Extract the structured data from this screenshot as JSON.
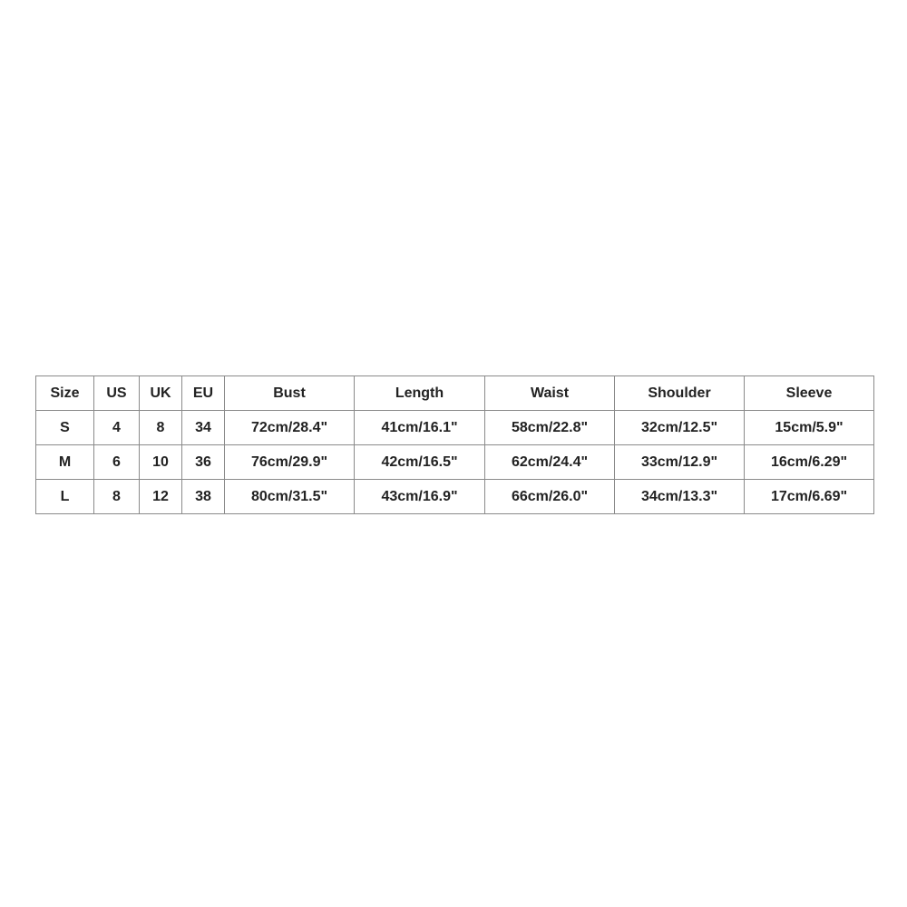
{
  "size_chart": {
    "headers": [
      "Size",
      "US",
      "UK",
      "EU",
      "Bust",
      "Length",
      "Waist",
      "Shoulder",
      "Sleeve"
    ],
    "rows": [
      [
        "S",
        "4",
        "8",
        "34",
        "72cm/28.4\"",
        "41cm/16.1\"",
        "58cm/22.8\"",
        "32cm/12.5\"",
        "15cm/5.9\""
      ],
      [
        "M",
        "6",
        "10",
        "36",
        "76cm/29.9\"",
        "42cm/16.5\"",
        "62cm/24.4\"",
        "33cm/12.9\"",
        "16cm/6.29\""
      ],
      [
        "L",
        "8",
        "12",
        "38",
        "80cm/31.5\"",
        "43cm/16.9\"",
        "66cm/26.0\"",
        "34cm/13.3\"",
        "17cm/6.69\""
      ]
    ]
  }
}
